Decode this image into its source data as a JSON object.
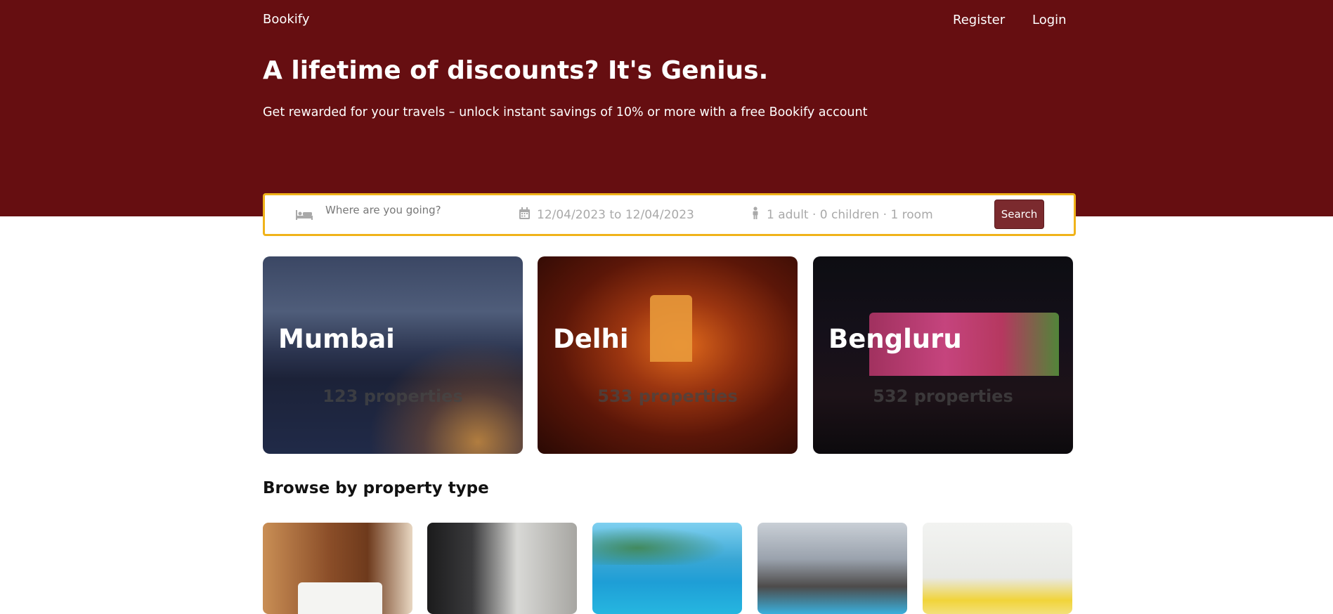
{
  "header": {
    "brand": "Bookify",
    "nav": {
      "register": "Register",
      "login": "Login"
    }
  },
  "hero": {
    "title": "A lifetime of discounts? It's Genius.",
    "subtitle": "Get rewarded for your travels – unlock instant savings of 10% or more with a free Bookify account"
  },
  "search": {
    "destination_placeholder": "Where are you going?",
    "dates": "12/04/2023 to 12/04/2023",
    "guests": "1 adult · 0 children · 1 room",
    "button_label": "Search"
  },
  "featured": [
    {
      "city": "Mumbai",
      "count": "123 properties"
    },
    {
      "city": "Delhi",
      "count": "533 properties"
    },
    {
      "city": "Bengluru",
      "count": "532 properties"
    }
  ],
  "property_types": {
    "title": "Browse by property type"
  },
  "colors": {
    "brand": "#660e11",
    "search_border": "#f0b31a",
    "search_button": "#7b2a2e"
  }
}
